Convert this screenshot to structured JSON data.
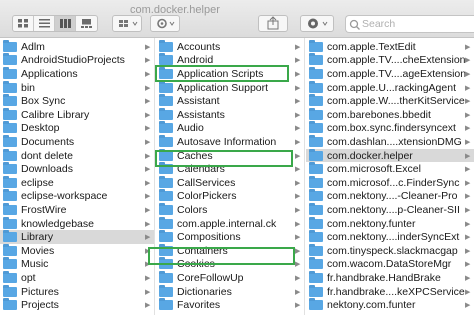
{
  "window": {
    "title": "com.docker.helper"
  },
  "search": {
    "placeholder": "Search"
  },
  "column1": [
    {
      "label": "Adlm",
      "selected": false
    },
    {
      "label": "AndroidStudioProjects",
      "selected": false
    },
    {
      "label": "Applications",
      "selected": false
    },
    {
      "label": "bin",
      "selected": false
    },
    {
      "label": "Box Sync",
      "selected": false
    },
    {
      "label": "Calibre Library",
      "selected": false
    },
    {
      "label": "Desktop",
      "selected": false
    },
    {
      "label": "Documents",
      "selected": false
    },
    {
      "label": "dont delete",
      "selected": false
    },
    {
      "label": "Downloads",
      "selected": false
    },
    {
      "label": "eclipse",
      "selected": false
    },
    {
      "label": "eclipse-workspace",
      "selected": false
    },
    {
      "label": "FrostWire",
      "selected": false
    },
    {
      "label": "knowledgebase",
      "selected": false
    },
    {
      "label": "Library",
      "selected": true
    },
    {
      "label": "Movies",
      "selected": false
    },
    {
      "label": "Music",
      "selected": false
    },
    {
      "label": "opt",
      "selected": false
    },
    {
      "label": "Pictures",
      "selected": false
    },
    {
      "label": "Projects",
      "selected": false
    }
  ],
  "column2": [
    {
      "label": "Accounts",
      "selected": false
    },
    {
      "label": "Android",
      "selected": false
    },
    {
      "label": "Application Scripts",
      "selected": false
    },
    {
      "label": "Application Support",
      "selected": false
    },
    {
      "label": "Assistant",
      "selected": false
    },
    {
      "label": "Assistants",
      "selected": false
    },
    {
      "label": "Audio",
      "selected": false
    },
    {
      "label": "Autosave Information",
      "selected": false
    },
    {
      "label": "Caches",
      "selected": false
    },
    {
      "label": "Calendars",
      "selected": false
    },
    {
      "label": "CallServices",
      "selected": false
    },
    {
      "label": "ColorPickers",
      "selected": false
    },
    {
      "label": "Colors",
      "selected": false
    },
    {
      "label": "com.apple.internal.ck",
      "selected": false
    },
    {
      "label": "Compositions",
      "selected": false
    },
    {
      "label": "Containers",
      "selected": false
    },
    {
      "label": "Cookies",
      "selected": false
    },
    {
      "label": "CoreFollowUp",
      "selected": false
    },
    {
      "label": "Dictionaries",
      "selected": false
    },
    {
      "label": "Favorites",
      "selected": false
    }
  ],
  "column3": [
    {
      "label": "com.apple.TextEdit",
      "selected": false
    },
    {
      "label": "com.apple.TV....cheExtension",
      "selected": false
    },
    {
      "label": "com.apple.TV....ageExtension",
      "selected": false
    },
    {
      "label": "com.apple.U...rackingAgent",
      "selected": false
    },
    {
      "label": "com.apple.W....therKitService",
      "selected": false
    },
    {
      "label": "com.barebones.bbedit",
      "selected": false
    },
    {
      "label": "com.box.sync.findersyncext",
      "selected": false
    },
    {
      "label": "com.dashlan....xtensionDMG",
      "selected": false
    },
    {
      "label": "com.docker.helper",
      "selected": true
    },
    {
      "label": "com.microsoft.Excel",
      "selected": false
    },
    {
      "label": "com.microsof...c.FinderSync",
      "selected": false
    },
    {
      "label": "com.nektony....-Cleaner-Pro",
      "selected": false
    },
    {
      "label": "com.nektony....p-Cleaner-SII",
      "selected": false
    },
    {
      "label": "com.nektony.funter",
      "selected": false
    },
    {
      "label": "com.nektony....inderSyncExt",
      "selected": false
    },
    {
      "label": "com.tinyspeck.slackmacgap",
      "selected": false
    },
    {
      "label": "com.wacom.DataStoreMgr",
      "selected": false
    },
    {
      "label": "fr.handbrake.HandBrake",
      "selected": false
    },
    {
      "label": "fr.handbrake....keXPCService",
      "selected": false
    },
    {
      "label": "nektony.com.funter",
      "selected": false
    }
  ],
  "highlights": [
    "Application Scripts",
    "Caches",
    "Containers"
  ],
  "colors": {
    "folder": "#58a7e4",
    "selection": "#d9d9d9",
    "highlight_box": "#3aa84a"
  }
}
